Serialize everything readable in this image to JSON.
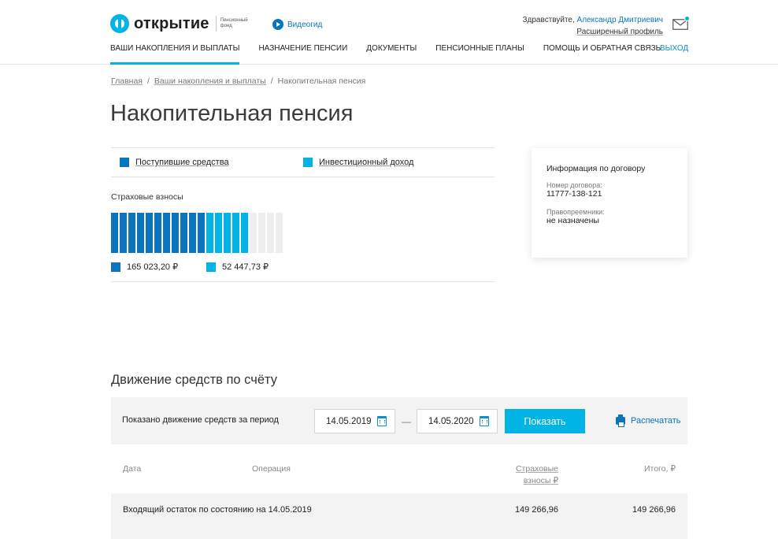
{
  "header": {
    "logo_text": "открытие",
    "logo_sub": "Пенсионный фонд",
    "video_label": "Видеогид",
    "greeting": "Здравствуйте,",
    "user_name": "Александр Дмитриевич",
    "profile_link": "Расширенный профиль"
  },
  "nav": {
    "items": [
      {
        "label": "ВАШИ НАКОПЛЕНИЯ И ВЫПЛАТЫ",
        "active": true
      },
      {
        "label": "НАЗНАЧЕНИЕ ПЕНСИИ",
        "active": false
      },
      {
        "label": "ДОКУМЕНТЫ",
        "active": false
      },
      {
        "label": "ПЕНСИОННЫЕ ПЛАНЫ",
        "active": false
      },
      {
        "label": "ПОМОЩЬ И ОБРАТНАЯ СВЯЗЬ",
        "active": false
      }
    ],
    "exit": "ВЫХОД"
  },
  "breadcrumb": {
    "home": "Главная",
    "section": "Ваши накопления и выплаты",
    "current": "Накопительная пенсия",
    "sep": "/"
  },
  "page": {
    "title": "Накопительная пенсия"
  },
  "legend": {
    "received": "Поступившие средства",
    "income": "Инвестиционный доход"
  },
  "insurance": {
    "label": "Страховые взносы",
    "received_amount": "165 023,20 ₽",
    "income_amount": "52 447,73 ₽",
    "segments_received": 11,
    "segments_income": 5,
    "segments_total": 20
  },
  "colors": {
    "accent": "#00b4e6",
    "brand": "#0a74bf",
    "empty": "#eeeeee"
  },
  "info": {
    "title": "Информация по договору",
    "contract_label": "Номер договора:",
    "contract_value": "11777-138-121",
    "successors_label": "Правопреемники:",
    "successors_value": "не назначены"
  },
  "movements": {
    "title": "Движение средств по счёту",
    "filter_label": "Показано движение средств за период",
    "date_from": "14.05.2019",
    "date_to": "14.05.2020",
    "dash": "—",
    "show_button": "Показать",
    "print": "Распечатать"
  },
  "table": {
    "col_date": "Дата",
    "col_operation": "Операция",
    "col_contributions_1": "Страховые",
    "col_contributions_2": "взносы ₽",
    "col_total": "Итого, ₽",
    "rows": [
      {
        "label": "Входящий остаток по состоянию на 14.05.2019",
        "contributions": "149 266,96",
        "total": "149 266,96"
      }
    ]
  }
}
